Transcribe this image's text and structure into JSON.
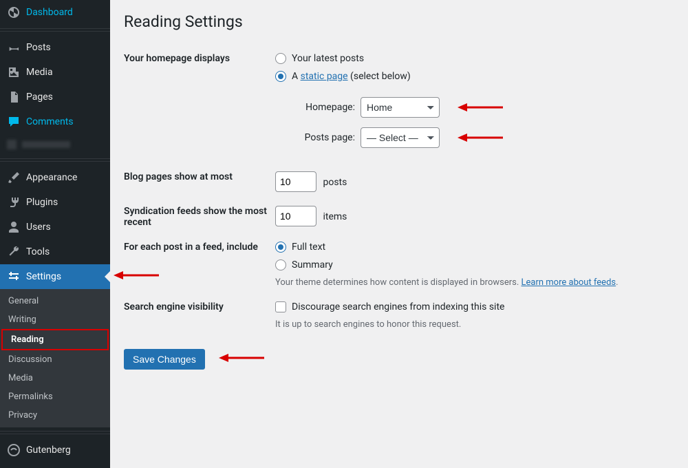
{
  "sidebar": {
    "items": [
      {
        "id": "dashboard",
        "label": "Dashboard",
        "icon": "dashboard-icon"
      },
      {
        "id": "posts",
        "label": "Posts",
        "icon": "pin-icon"
      },
      {
        "id": "media",
        "label": "Media",
        "icon": "media-icon"
      },
      {
        "id": "pages",
        "label": "Pages",
        "icon": "page-icon"
      },
      {
        "id": "comments",
        "label": "Comments",
        "icon": "comment-icon",
        "highlight": true
      },
      {
        "id": "appearance",
        "label": "Appearance",
        "icon": "brush-icon"
      },
      {
        "id": "plugins",
        "label": "Plugins",
        "icon": "plug-icon"
      },
      {
        "id": "users",
        "label": "Users",
        "icon": "user-icon"
      },
      {
        "id": "tools",
        "label": "Tools",
        "icon": "wrench-icon"
      },
      {
        "id": "settings",
        "label": "Settings",
        "icon": "sliders-icon",
        "active": true
      },
      {
        "id": "gutenberg",
        "label": "Gutenberg",
        "icon": "gutenberg-icon"
      }
    ],
    "settings_submenu": [
      {
        "id": "general",
        "label": "General"
      },
      {
        "id": "writing",
        "label": "Writing"
      },
      {
        "id": "reading",
        "label": "Reading",
        "current": true
      },
      {
        "id": "discussion",
        "label": "Discussion"
      },
      {
        "id": "media",
        "label": "Media"
      },
      {
        "id": "permalinks",
        "label": "Permalinks"
      },
      {
        "id": "privacy",
        "label": "Privacy"
      }
    ]
  },
  "page": {
    "title": "Reading Settings",
    "homepage_section": {
      "heading": "Your homepage displays",
      "option_latest": "Your latest posts",
      "option_static_prefix": "A ",
      "option_static_link": "static page",
      "option_static_suffix": " (select below)",
      "selected": "static",
      "homepage_label": "Homepage:",
      "homepage_value": "Home",
      "postspage_label": "Posts page:",
      "postspage_value": "— Select —"
    },
    "blog_pages": {
      "heading": "Blog pages show at most",
      "value": "10",
      "suffix": "posts"
    },
    "syndication": {
      "heading": "Syndication feeds show the most recent",
      "value": "10",
      "suffix": "items"
    },
    "feed_content": {
      "heading": "For each post in a feed, include",
      "option_full": "Full text",
      "option_summary": "Summary",
      "selected": "full",
      "desc_prefix": "Your theme determines how content is displayed in browsers. ",
      "desc_link": "Learn more about feeds",
      "desc_suffix": "."
    },
    "seo": {
      "heading": "Search engine visibility",
      "checkbox_label": "Discourage search engines from indexing this site",
      "checked": false,
      "desc": "It is up to search engines to honor this request."
    },
    "save_label": "Save Changes"
  },
  "colors": {
    "accent": "#2271b1",
    "sidebar_bg": "#1d2327",
    "annotation": "#d80000"
  }
}
